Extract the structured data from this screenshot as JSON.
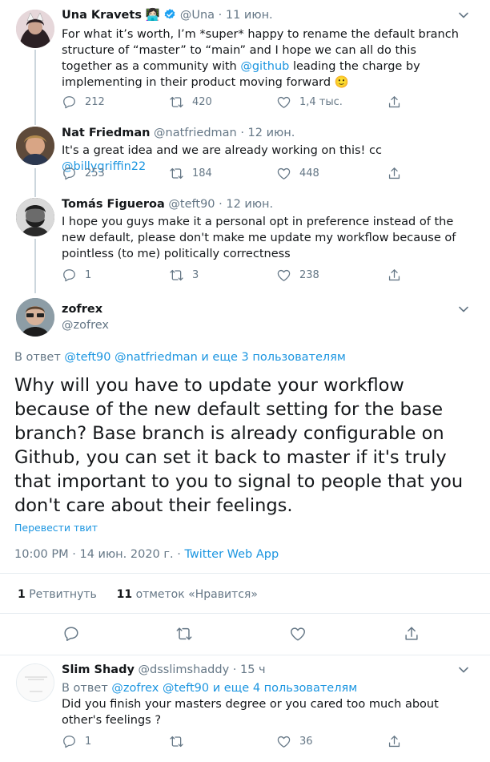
{
  "tweets": [
    {
      "name": "Una Kravets",
      "emoji": "👩🏻‍💻",
      "handle": "@Una",
      "date": "· 11 июн.",
      "text_parts": [
        "For what it’s worth, I’m *super* happy to rename the default branch structure of “master” to “main” and I hope we can all do this together as a community with ",
        "@github",
        " leading the charge by implementing in their product moving forward "
      ],
      "emoji_end": "🙂",
      "replies": "212",
      "retweets": "420",
      "likes": "1,4 тыс."
    },
    {
      "name": "Nat Friedman",
      "handle": "@natfriedman",
      "date": "· 12 июн.",
      "text_parts": [
        "It's a great idea and we are already working on this! cc ",
        "@billygriffin22"
      ],
      "replies": "253",
      "retweets": "184",
      "likes": "448"
    },
    {
      "name": "Tomás Figueroa",
      "handle": "@teft90",
      "date": "· 12 июн.",
      "text": "I hope you guys make it a personal opt in preference instead of the new default, please don't make me update my workflow because of pointless (to me) politically correctness",
      "replies": "1",
      "retweets": "3",
      "likes": "238"
    }
  ],
  "main": {
    "name": "zofrex",
    "handle": "@zofrex",
    "replying_prefix": "В ответ ",
    "replying_links": "@teft90 @natfriedman и еще 3 пользователям",
    "text": "Why will you have to update your workflow because of the new default setting for the base branch? Base branch is already configurable on Github, you can set it back to master if it's truly that important to you to signal to people that you don't care about their feelings.",
    "translate": "Перевести твит",
    "timestamp": "10:00 PM · 14 июн. 2020 г. · ",
    "source": "Twitter Web App",
    "retweet_count": "1",
    "retweet_label": "Ретвитнуть",
    "like_count": "11",
    "like_label": "отметок «Нравится»"
  },
  "reply": {
    "name": "Slim Shady",
    "handle": "@dsslimshaddy",
    "date": "· 15 ч",
    "replying_prefix": "В ответ ",
    "replying_links": "@zofrex @teft90 и еще 4 пользователям",
    "text": "Did you finish your masters degree or you cared too much about other's feelings ?",
    "replies": "1",
    "likes": "36"
  },
  "colors": {
    "link": "#1b95e0",
    "muted": "#657786",
    "verified": "#1da1f2"
  },
  "icons": [
    "reply-icon",
    "retweet-icon",
    "like-icon",
    "share-icon",
    "chevron-down-icon",
    "verified-icon"
  ]
}
